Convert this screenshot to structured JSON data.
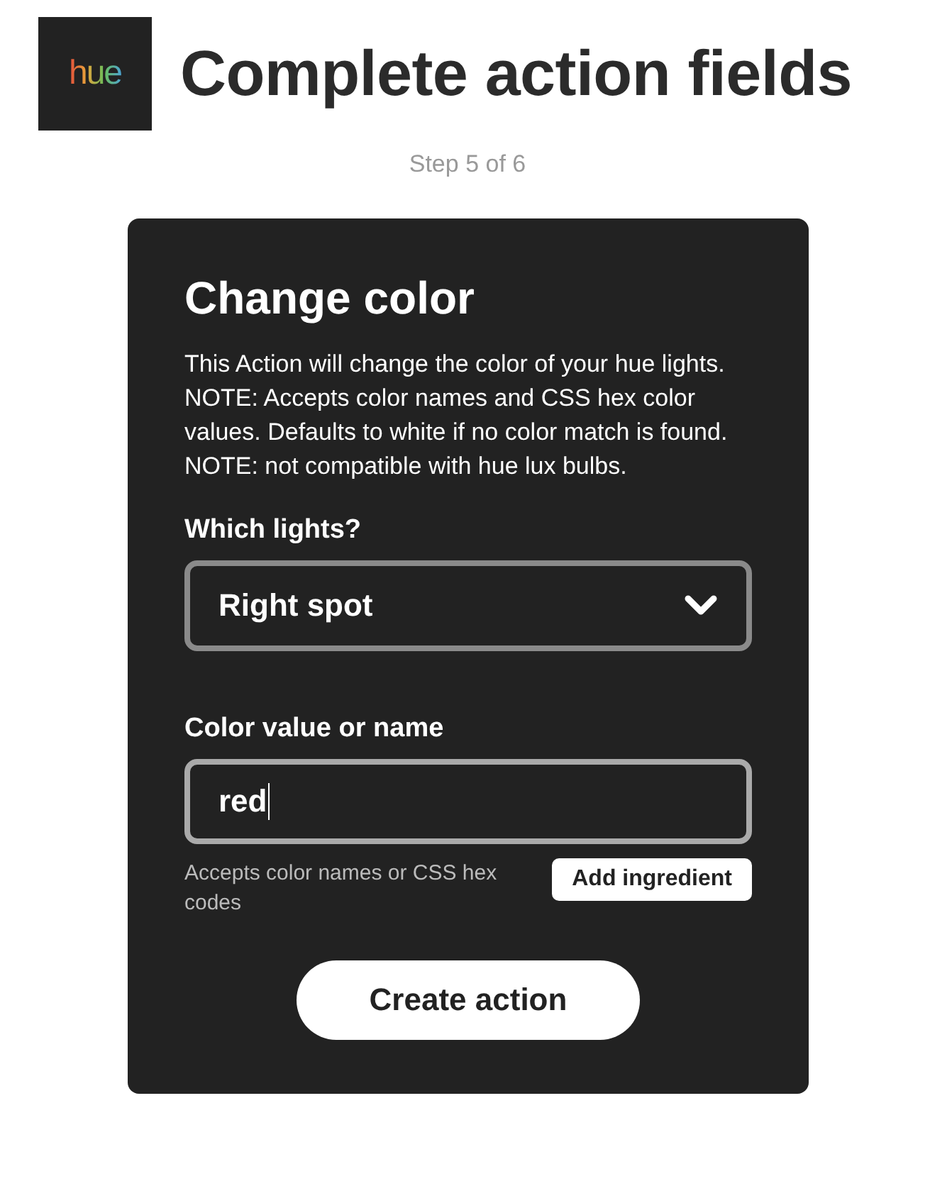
{
  "header": {
    "logo_text": "hue",
    "title": "Complete action fields",
    "step": "Step 5 of 6"
  },
  "action": {
    "title": "Change color",
    "description": "This Action will change the color of your hue lights. NOTE: Accepts color names and CSS hex color values. Defaults to white if no color match is found. NOTE: not compatible with hue lux bulbs.",
    "fields": [
      {
        "kind": "select",
        "label": "Which lights?",
        "value": "Right spot"
      },
      {
        "kind": "text",
        "label": "Color value or name",
        "value": "red",
        "focused": true,
        "helper": "Accepts color names or CSS hex codes",
        "button": "Add ingredient"
      }
    ]
  },
  "submit": "Create action"
}
